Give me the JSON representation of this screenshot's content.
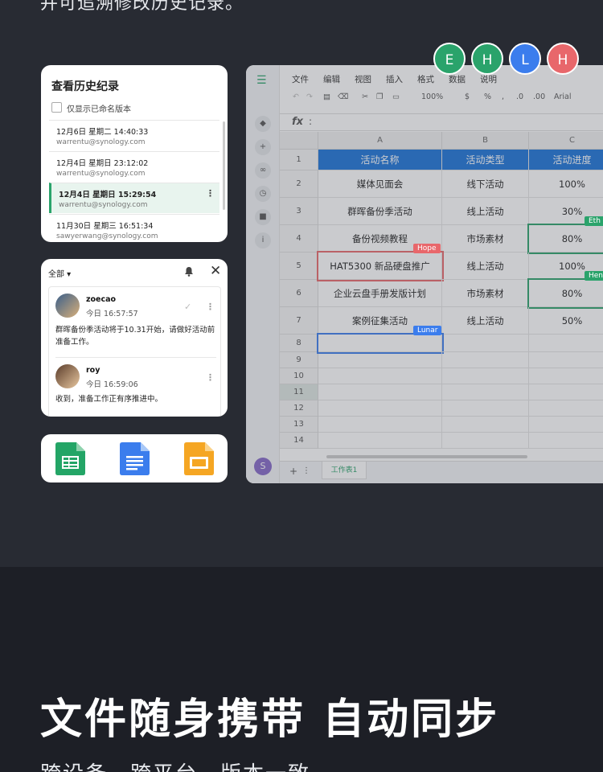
{
  "hero": {
    "top_text": "并可追溯修改历史记录。",
    "title": "文件随身携带 自动同步",
    "subtitle": "跨设备、跨平台，版本一致"
  },
  "history_panel": {
    "title": "查看历史纪录",
    "filter_label": "仅显示已命名版本",
    "items": [
      {
        "date": "12月6日 星期二 14:40:33",
        "user": "warrentu@synology.com"
      },
      {
        "date": "12月4日 星期日 23:12:02",
        "user": "warrentu@synology.com"
      },
      {
        "date": "12月4日 星期日 15:29:54",
        "user": "warrentu@synology.com"
      },
      {
        "date": "11月30日 星期三 16:51:34",
        "user": "sawyerwang@synology.com"
      }
    ],
    "more_icon": "⋮"
  },
  "notification_panel": {
    "filter": "全部 ▾",
    "bell_icon": "🔔",
    "close_icon": "✕",
    "items": [
      {
        "name": "zoecao",
        "time": "今日 16:57:57",
        "message": "群晖备份季活动将于10.31开始，请做好活动前准备工作。"
      },
      {
        "name": "roy",
        "time": "今日 16:59:06",
        "message": "收到，准备工作正有序推进中。"
      }
    ]
  },
  "apps": [
    {
      "name": "sheets-icon",
      "color": "#23a566"
    },
    {
      "name": "docs-icon",
      "color": "#3b7ded"
    },
    {
      "name": "slides-icon",
      "color": "#f5a623"
    }
  ],
  "presence": [
    {
      "letter": "E",
      "color": "#2aa36b"
    },
    {
      "letter": "H",
      "color": "#2aa36b"
    },
    {
      "letter": "L",
      "color": "#3b7ded"
    },
    {
      "letter": "H",
      "color": "#e8676b"
    }
  ],
  "spreadsheet": {
    "menu": [
      "文件",
      "编辑",
      "视图",
      "插入",
      "格式",
      "数据",
      "说明"
    ],
    "toolbar": {
      "zoom": "100%",
      "currency": "$",
      "percent": "%",
      "comma": ",",
      "dec_dec": ".0",
      "inc_dec": ".00",
      "font": "Arial"
    },
    "fx_label": "fx",
    "fx_colon": ":",
    "columns": [
      "A",
      "B",
      "C"
    ],
    "rows": [
      "1",
      "2",
      "3",
      "4",
      "5",
      "6",
      "7",
      "8",
      "9",
      "10",
      "11",
      "12",
      "13",
      "14"
    ],
    "header": [
      "活动名称",
      "活动类型",
      "活动进度"
    ],
    "data": [
      [
        "媒体见面会",
        "线下活动",
        "100%"
      ],
      [
        "群晖备份季活动",
        "线上活动",
        "30%"
      ],
      [
        "备份视频教程",
        "市场素材",
        "80%"
      ],
      [
        "HAT5300 新品硬盘推广",
        "线上活动",
        "100%"
      ],
      [
        "企业云盘手册发版计划",
        "市场素材",
        "80%"
      ],
      [
        "案例征集活动",
        "线上活动",
        "50%"
      ]
    ],
    "tags": {
      "hope": "Hope",
      "lunar": "Lunar",
      "eth": "Eth",
      "hen": "Hen"
    },
    "sheet_tab": "工作表1",
    "add_sheet": "+",
    "sheet_menu": "⋮",
    "user_avatar": "S"
  }
}
